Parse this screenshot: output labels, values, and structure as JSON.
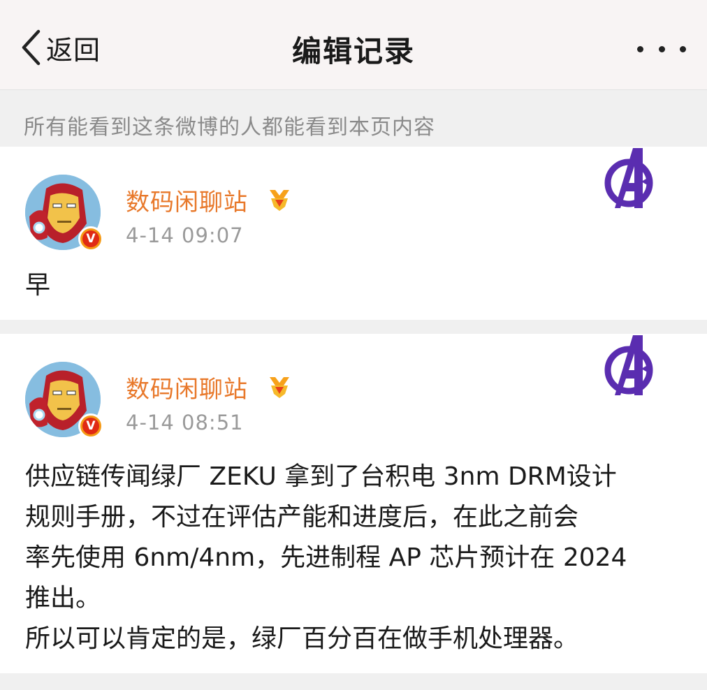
{
  "nav": {
    "back_label": "返回",
    "title": "编辑记录"
  },
  "notice": "所有能看到这条微博的人都能看到本页内容",
  "posts": [
    {
      "user": "数码闲聊站",
      "time": "4-14 09:07",
      "verified_mark": "V",
      "content": [
        "早"
      ]
    },
    {
      "user": "数码闲聊站",
      "time": "4-14 08:51",
      "verified_mark": "V",
      "content": [
        "供应链传闻绿厂 ZEKU 拿到了台积电 3nm DRM设计",
        "规则手册，不过在评估产能和进度后，在此之前会",
        "率先使用 6nm/4nm，先进制程 AP 芯片预计在 2024",
        "推出。",
        "所以可以肯定的是，绿厂百分百在做手机处理器。"
      ]
    }
  ],
  "icons": {
    "back": "chevron-left-icon",
    "more": "more-dots-icon",
    "medal": "vip-medal-icon",
    "avatar": "iron-man-avatar",
    "badge": "avengers-logo-badge"
  },
  "colors": {
    "username": "#e8782a",
    "verified_outer": "#f59a16",
    "verified_inner": "#e02a14",
    "timestamp": "#9a9a9a",
    "notice_text": "#8a8a8a",
    "badge_purple": "#5a2db0"
  }
}
